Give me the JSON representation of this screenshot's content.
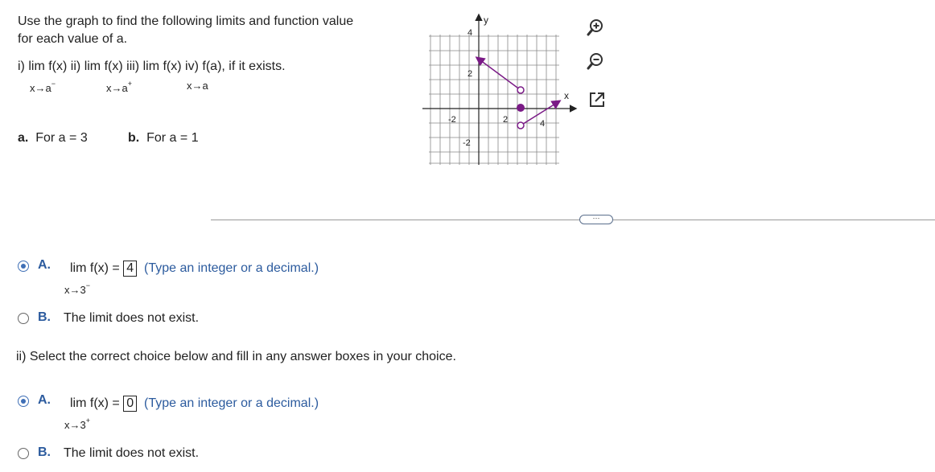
{
  "question": {
    "line1": "Use the graph to find the following limits and function value",
    "line2": "for each value of a.",
    "parts": {
      "i_label": "i)",
      "ii_label": "ii)",
      "iii_label": "iii)",
      "iv_label": "iv)",
      "lim": "lim",
      "fx": "f(x)",
      "fa": "f(a), if it exists.",
      "sub_left": "x→a",
      "sub_right": "x→a",
      "sub_two": "x→a",
      "minus": "−",
      "plus": "+"
    },
    "a_label": "a.",
    "a_text": "For a = 3",
    "b_label": "b.",
    "b_text": "For a = 1"
  },
  "graph": {
    "x_axis_label": "x",
    "y_axis_label": "y",
    "tick_x_neg2": "-2",
    "tick_x_2": "2",
    "tick_x_4": "4",
    "tick_y_4": "4",
    "tick_y_2": "2",
    "tick_y_neg2": "-2",
    "line_color": "#7a1a86"
  },
  "toolbar": {
    "zoom_in": "zoom-in-icon",
    "zoom_out": "zoom-out-icon",
    "popout": "popout-icon"
  },
  "more_button": "···",
  "answers": {
    "part1": {
      "A_letter": "A.",
      "A_lim": "lim f(x) =",
      "A_value": "4",
      "A_hint": "(Type an integer or a decimal.)",
      "A_sub": "x→3",
      "A_sup": "−",
      "B_letter": "B.",
      "B_text": "The limit does not exist."
    },
    "instruction": "ii) Select the correct choice below and fill in any answer boxes in your choice.",
    "part2": {
      "A_letter": "A.",
      "A_lim": "lim f(x) =",
      "A_value": "0",
      "A_hint": "(Type an integer or a decimal.)",
      "A_sub": "x→3",
      "A_sup": "+",
      "B_letter": "B.",
      "B_text": "The limit does not exist."
    }
  }
}
